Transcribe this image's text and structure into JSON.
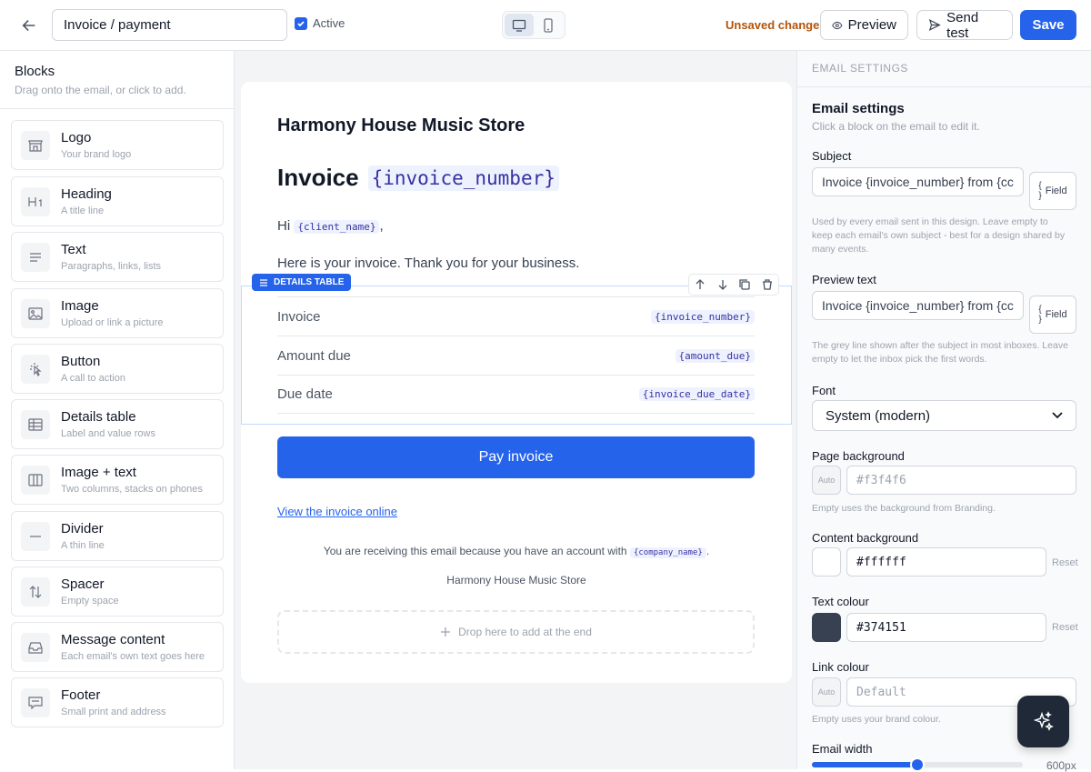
{
  "header": {
    "title_value": "Invoice / payment",
    "active_label": "Active",
    "unsaved": "Unsaved changes",
    "preview_label": "Preview",
    "send_test_label": "Send test",
    "save_label": "Save"
  },
  "blocks": {
    "title": "Blocks",
    "subtitle": "Drag onto the email, or click to add.",
    "items": [
      {
        "label": "Logo",
        "desc": "Your brand logo",
        "icon": "store-icon"
      },
      {
        "label": "Heading",
        "desc": "A title line",
        "icon": "heading-icon"
      },
      {
        "label": "Text",
        "desc": "Paragraphs, links, lists",
        "icon": "text-icon"
      },
      {
        "label": "Image",
        "desc": "Upload or link a picture",
        "icon": "image-icon"
      },
      {
        "label": "Button",
        "desc": "A call to action",
        "icon": "pointer-icon"
      },
      {
        "label": "Details table",
        "desc": "Label and value rows",
        "icon": "table-icon"
      },
      {
        "label": "Image + text",
        "desc": "Two columns, stacks on phones",
        "icon": "columns-icon"
      },
      {
        "label": "Divider",
        "desc": "A thin line",
        "icon": "divider-icon"
      },
      {
        "label": "Spacer",
        "desc": "Empty space",
        "icon": "spacer-icon"
      },
      {
        "label": "Message content",
        "desc": "Each email's own text goes here",
        "icon": "inbox-icon"
      },
      {
        "label": "Footer",
        "desc": "Small print and address",
        "icon": "footer-icon"
      }
    ]
  },
  "email": {
    "store_name": "Harmony House Music Store",
    "heading_prefix": "Invoice",
    "heading_field": "{invoice_number}",
    "greeting_prefix": "Hi",
    "greeting_field": "{client_name}",
    "greeting_suffix": ",",
    "body": "Here is your invoice. Thank you for your business.",
    "details_label": "DETAILS TABLE",
    "rows": [
      {
        "key": "Invoice",
        "value": "{invoice_number}"
      },
      {
        "key": "Amount due",
        "value": "{amount_due}"
      },
      {
        "key": "Due date",
        "value": "{invoice_due_date}"
      }
    ],
    "pay_button": "Pay invoice",
    "view_link": "View the invoice online",
    "receiving_prefix": "You are receiving this email because you have an account with",
    "receiving_field": "{company_name}",
    "receiving_suffix": ".",
    "footer_store": "Harmony House Music Store",
    "drop_text": "Drop here to add at the end"
  },
  "settings": {
    "section_header": "EMAIL SETTINGS",
    "title": "Email settings",
    "subtitle": "Click a block on the email to edit it.",
    "subject_label": "Subject",
    "subject_value": "Invoice {invoice_number} from {cc",
    "field_button": "Field",
    "field_brace_open": "{",
    "field_brace_close": "}",
    "subject_hint": "Used by every email sent in this design. Leave empty to keep each email's own subject - best for a design shared by many events.",
    "preview_label": "Preview text",
    "preview_value": "Invoice {invoice_number} from {cc",
    "preview_hint": "The grey line shown after the subject in most inboxes. Leave empty to let the inbox pick the first words.",
    "font_label": "Font",
    "font_value": "System (modern)",
    "page_bg_label": "Page background",
    "page_bg_auto": "Auto",
    "page_bg_placeholder": "#f3f4f6",
    "page_bg_hint": "Empty uses the background from Branding.",
    "content_bg_label": "Content background",
    "content_bg_value": "#ffffff",
    "content_bg_color": "#ffffff",
    "text_colour_label": "Text colour",
    "text_colour_value": "#374151",
    "text_colour_color": "#374151",
    "reset_label": "Reset",
    "link_colour_label": "Link colour",
    "link_colour_auto": "Auto",
    "link_colour_placeholder": "Default",
    "link_colour_hint": "Empty uses your brand colour.",
    "width_label": "Email width",
    "width_value": "600px",
    "width_fraction": 0.5
  },
  "colors": {
    "accent": "#2563eb",
    "unsaved": "#b45309"
  }
}
